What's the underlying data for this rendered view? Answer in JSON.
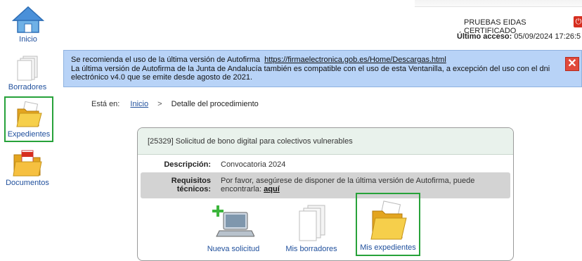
{
  "sidebar": {
    "items": [
      {
        "label": "Inicio",
        "icon": "home-icon"
      },
      {
        "label": "Borradores",
        "icon": "documents-stack-icon"
      },
      {
        "label": "Expedientes",
        "icon": "folder-icon"
      },
      {
        "label": "Documentos",
        "icon": "pdf-folder-icon"
      }
    ]
  },
  "user": {
    "name": "PRUEBAS EIDAS CERTIFICADO",
    "last_access_label": "Último acceso:",
    "last_access_value": "05/09/2024 17:26:5"
  },
  "banner": {
    "line1_text": "Se recomienda el uso de la última versión de Autofirma",
    "line1_link": "https://firmaelectronica.gob.es/Home/Descargas.html",
    "line2": "La última versión de Autofirma de la Junta de Andalucía también es compatible con el uso de esta Ventanilla, a excepción del uso con el dni",
    "line3": "electrónico v4.0 que se emite desde agosto de 2021.",
    "close_symbol": "✕"
  },
  "breadcrumb": {
    "prefix": "Está en:",
    "home_link": "Inicio",
    "separator": ">",
    "current": "Detalle del procedimiento"
  },
  "procedure": {
    "title": "[25329] Solicitud de bono digital para colectivos vulnerables",
    "description_label": "Descripción:",
    "description_value": "Convocatoria 2024",
    "requirements_label": "Requisitos técnicos:",
    "requirements_line1": "Por favor, asegúrese de disponer de la última versión de Autofirma, puede",
    "requirements_line2": "encontrarla:",
    "requirements_link": "aquí"
  },
  "actions": [
    {
      "label": "Nueva solicitud",
      "icon": "new-application-laptop-icon"
    },
    {
      "label": "Mis borradores",
      "icon": "drafts-stack-icon"
    },
    {
      "label": "Mis expedientes",
      "icon": "folder-icon"
    }
  ],
  "colors": {
    "link": "#1f4f9c",
    "banner_bg": "#b8d3f7",
    "selected_border": "#27a23a",
    "card_header_bg": "#e9f2ec",
    "close_red": "#e14a3b"
  }
}
